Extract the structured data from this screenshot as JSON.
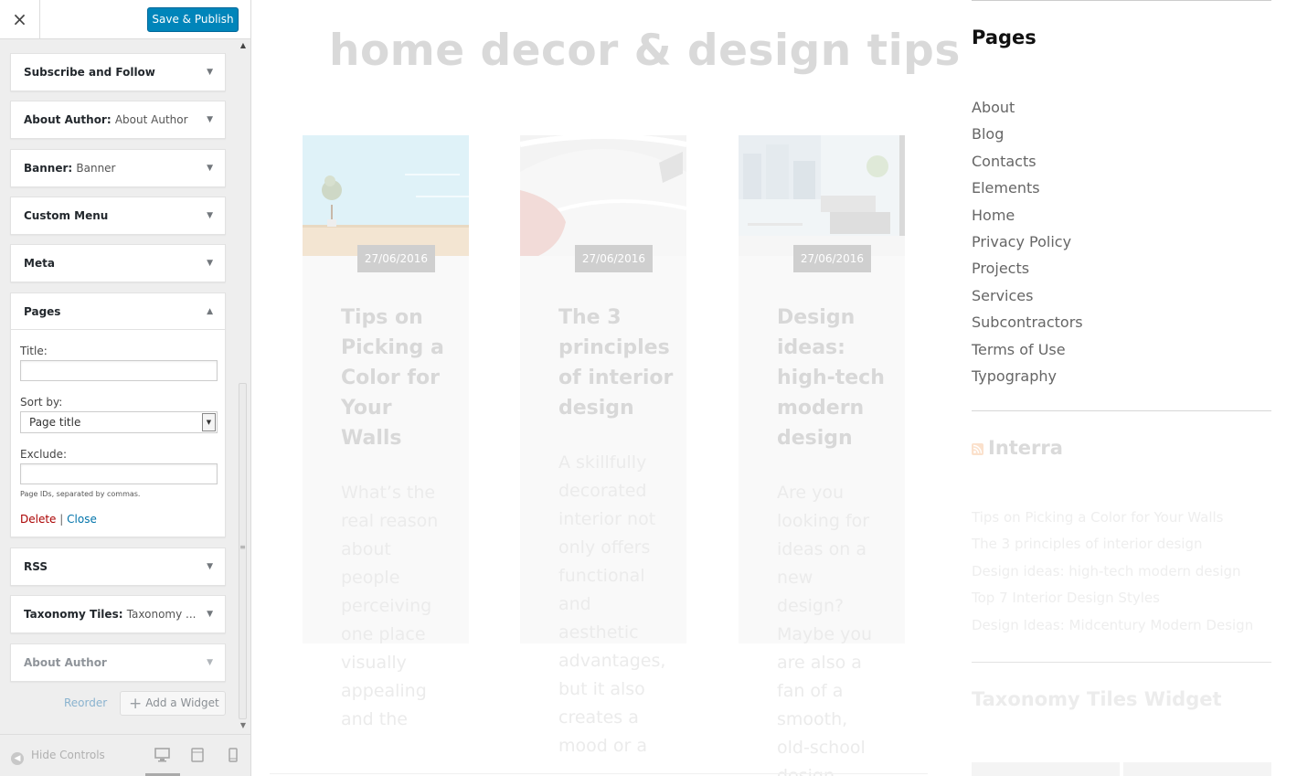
{
  "customizer": {
    "close_icon": "×",
    "save_label": "Save & Publish",
    "widgets_before": [
      {
        "name": "Subscribe and Follow",
        "instance": ""
      },
      {
        "name": "About Author",
        "instance": "About Author"
      },
      {
        "name": "Banner",
        "instance": "Banner"
      },
      {
        "name": "Custom Menu",
        "instance": ""
      },
      {
        "name": "Meta",
        "instance": ""
      }
    ],
    "expanded_widget": {
      "name": "Pages",
      "title_label": "Title:",
      "title_value": "",
      "sort_label": "Sort by:",
      "sort_value": "Page title",
      "exclude_label": "Exclude:",
      "exclude_value": "",
      "hint": "Page IDs, separated by commas.",
      "delete_label": "Delete",
      "separator": "|",
      "close_label": "Close"
    },
    "widgets_after": [
      {
        "name": "RSS",
        "instance": ""
      },
      {
        "name": "Taxonomy Tiles",
        "instance": "Taxonomy ..."
      },
      {
        "name": "About Author",
        "instance": ""
      }
    ],
    "reorder_label": "Reorder",
    "add_widget_label": "Add a Widget",
    "hide_controls_label": "Hide Controls",
    "devices": [
      "desktop-icon",
      "tablet-icon",
      "mobile-icon"
    ]
  },
  "preview": {
    "site_title": "home decor & design tips",
    "posts": [
      {
        "date": "27/06/2016",
        "title": "Tips on Picking a Color for Your Walls",
        "excerpt": "What’s the real reason about people perceiving one place visually appealing and the"
      },
      {
        "date": "27/06/2016",
        "title": "The 3 principles of interior design",
        "excerpt": "A skillfully decorated interior not only offers functional and aesthetic advantages, but it also creates a mood or a"
      },
      {
        "date": "27/06/2016",
        "title": "Design ideas: high-tech modern design",
        "excerpt": "Are you looking for ideas on a new design? Maybe you are also a fan of a smooth, old-school design"
      }
    ],
    "pages_widget": {
      "heading": "Pages",
      "items": [
        "About",
        "Blog",
        "Contacts",
        "Elements",
        "Home",
        "Privacy Policy",
        "Projects",
        "Services",
        "Subcontractors",
        "Terms of Use",
        "Typography"
      ]
    },
    "rss_widget": {
      "heading": "Interra",
      "items": [
        "Tips on Picking a Color for Your Walls",
        "The 3 principles of interior design",
        "Design ideas: high-tech modern design",
        "Top 7 Interior Design Styles",
        "Design Ideas: Midcentury Modern Design"
      ]
    },
    "taxonomy_widget": {
      "heading": "Taxonomy Tiles Widget"
    }
  },
  "colors": {
    "primary_button": "#0085ba",
    "delete_link": "#aa0000",
    "link": "#0073aa",
    "rss_icon": "#f5a35c"
  }
}
